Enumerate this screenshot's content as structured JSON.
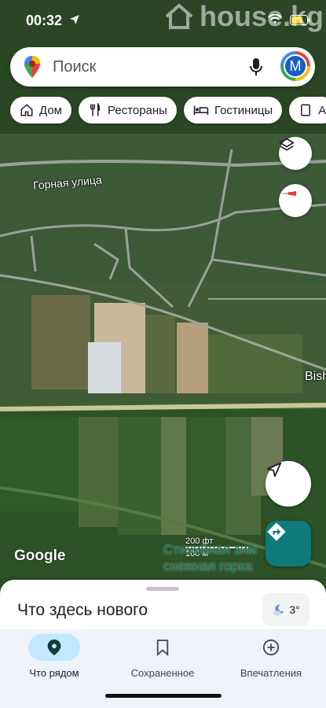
{
  "status_bar": {
    "time": "00:32"
  },
  "watermark": {
    "text": "house.kg"
  },
  "search": {
    "placeholder": "Поиск",
    "avatar_letter": "M"
  },
  "chips": [
    {
      "label": "Дом",
      "icon": "home-icon"
    },
    {
      "label": "Рестораны",
      "icon": "restaurant-icon"
    },
    {
      "label": "Гостиницы",
      "icon": "hotel-icon"
    },
    {
      "label": "А",
      "icon": "attraction-icon"
    }
  ],
  "map": {
    "street_label": "Горная улица",
    "city_label": "Bishke",
    "poi_label_line1": "Стихийная зим",
    "poi_label_line2": "снежная горка",
    "scale_ft": "200 фт",
    "scale_m": "100 м",
    "google": "Google"
  },
  "sheet": {
    "title": "Что здесь нового",
    "temperature": "3°"
  },
  "nav": [
    {
      "label": "Что рядом",
      "icon": "location-pin-icon",
      "active": true
    },
    {
      "label": "Сохраненное",
      "icon": "bookmark-icon",
      "active": false
    },
    {
      "label": "Впечатления",
      "icon": "add-circle-icon",
      "active": false
    }
  ],
  "colors": {
    "accent": "#0f7a7a",
    "active_nav": "#c2e7ff"
  }
}
